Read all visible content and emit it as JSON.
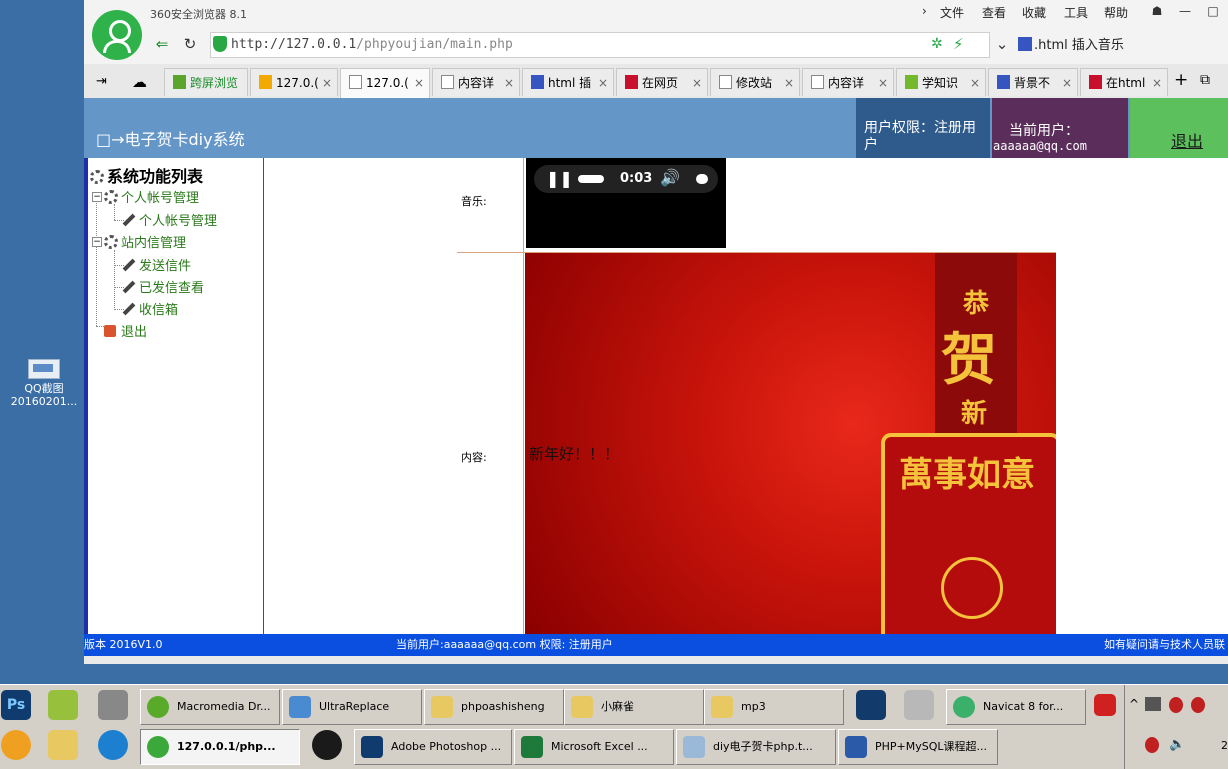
{
  "desktop": {
    "icon_label_1": "QQ截图",
    "icon_label_2": "20160201..."
  },
  "browser": {
    "brand": "360安全浏览器 8.1",
    "menu": [
      "文件",
      "查看",
      "收藏",
      "工具",
      "帮助"
    ],
    "url_host": "http://127.0.0.1",
    "url_path": "/phpyoujian/main.php",
    "search_text": ".html 插入音乐",
    "tabs": [
      {
        "label": "跨屏浏览"
      },
      {
        "label": "127.0.("
      },
      {
        "label": "127.0.("
      },
      {
        "label": "内容详"
      },
      {
        "label": "html 插"
      },
      {
        "label": "在网页"
      },
      {
        "label": "修改站"
      },
      {
        "label": "内容详"
      },
      {
        "label": "学知识"
      },
      {
        "label": "背景不"
      },
      {
        "label": "在html"
      }
    ]
  },
  "page": {
    "title": "□→电子贺卡diy系统",
    "perm_label": "用户权限：注册用户",
    "user_label": "当前用户：",
    "user_email": "aaaaaa@qq.com",
    "logout": "退出",
    "sidebar": {
      "title": "系统功能列表",
      "group1": "个人帐号管理",
      "group1_item": "个人帐号管理",
      "group2": "站内信管理",
      "items": [
        "发送信件",
        "已发信查看",
        "收信箱"
      ],
      "exit": "退出"
    },
    "music_label": "音乐:",
    "player_time": "0:03",
    "content_label": "内容:",
    "card_text": "新年好！！！",
    "card_art": {
      "top": "恭",
      "big": "贺",
      "bottom": "新",
      "seal": "萬事如意"
    },
    "footer_version": "版本 2016V1.0",
    "footer_user": "当前用户:aaaaaa@qq.com 权限: 注册用户",
    "footer_help": "如有疑问请与技术人员联"
  },
  "taskbar": {
    "row1": [
      "Macromedia Dr...",
      "UltraReplace",
      "phpoashisheng",
      "小麻雀",
      "mp3",
      "Navicat 8 for..."
    ],
    "row2": [
      "127.0.0.1/php...",
      "Adobe Photoshop ...",
      "Microsoft Excel ...",
      "diy电子贺卡php.t...",
      "PHP+MySQL课程超..."
    ],
    "clock": "2"
  },
  "colors": {
    "header": "#6496c8",
    "perm": "#2f5a8c",
    "user": "#5a2d5a",
    "logout": "#5cc15c",
    "footer": "#0a4fe0"
  }
}
